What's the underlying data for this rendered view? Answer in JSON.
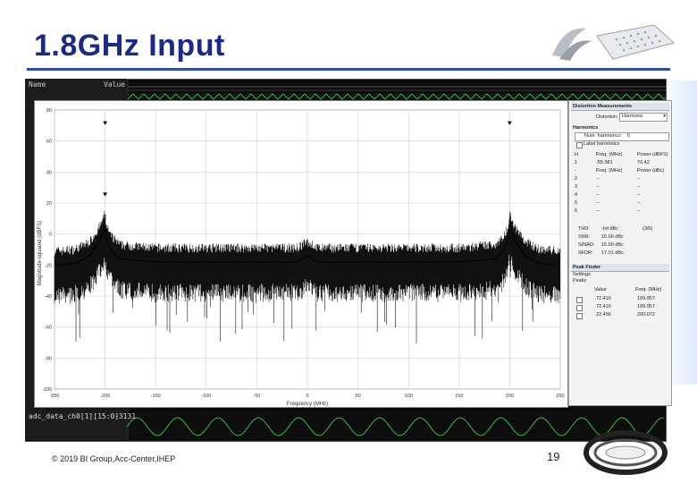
{
  "slide": {
    "title": "1.8GHz Input",
    "footer": "© 2019 BI Group,Acc-Center,IHEP",
    "page_number": "19"
  },
  "scope": {
    "col_name": "Name",
    "col_value": "Value",
    "footer_label": "adc_data_ch0[1][15:0]",
    "footer_value": "-3131"
  },
  "chart_data": {
    "type": "line",
    "xlabel": "Frequency (MHz)",
    "ylabel": "Magnitude-squared (dBFS)",
    "xlim": [
      -250,
      250
    ],
    "ylim": [
      -100,
      80
    ],
    "xticks": [
      -250,
      -200,
      -150,
      -100,
      -50,
      0,
      50,
      100,
      150,
      200,
      250
    ],
    "yticks": [
      80,
      60,
      40,
      20,
      0,
      -20,
      -40,
      -60,
      -80,
      -100
    ],
    "grid": true,
    "series": [
      {
        "x": [
          -250,
          -230,
          -215,
          -205,
          -201,
          -200,
          -199,
          -195,
          -185,
          -150,
          -100,
          -50,
          -10,
          0,
          10,
          50,
          100,
          150,
          185,
          195,
          199,
          200,
          201,
          205,
          215,
          230,
          250
        ],
        "y": [
          -20,
          -19,
          -14,
          -4,
          2,
          5,
          -2,
          -10,
          -16,
          -18,
          -18,
          -18,
          -18,
          -14,
          -18,
          -18,
          -18,
          -18,
          -16,
          -10,
          -2,
          5,
          2,
          -4,
          -14,
          -19,
          -20
        ]
      }
    ],
    "markers": [
      {
        "x": -200,
        "y": 71
      },
      {
        "x": -200,
        "y": 25
      },
      {
        "x": 200,
        "y": 71
      }
    ]
  },
  "panel": {
    "dist_header": "Distortion Measurements",
    "dist_label": "Distortion:",
    "dist_value": "Harmonic",
    "harm_header": "Harmonics",
    "num_harm_label": "Num. harmonics:",
    "num_harm_value": "6",
    "label_harm": "Label harmonics",
    "table_cols": [
      "H",
      "Freq. (MHz)",
      "Power (dBFS)"
    ],
    "rows": [
      [
        "1",
        "-55.981",
        "73.42"
      ],
      [
        "-",
        "Freq. (MHz)",
        "Power (dBc)"
      ],
      [
        "2",
        "--",
        "--"
      ],
      [
        "3",
        "--",
        "--"
      ],
      [
        "4",
        "--",
        "--"
      ],
      [
        "5",
        "--",
        "--"
      ],
      [
        "6",
        "--",
        "--"
      ]
    ],
    "metrics": [
      [
        "THD:",
        "-Inf dBc",
        "(3/6)"
      ],
      [
        "SNR:",
        "15.00 dBc",
        ""
      ],
      [
        "SINAD:",
        "15.00 dBc",
        ""
      ],
      [
        "SFDR:",
        "17.01 dBc",
        ""
      ]
    ],
    "peak_header": "Peak Finder",
    "settings_label": "Settings",
    "peaks_label": "Peaks",
    "peak_cols": [
      "Value",
      "Freq. (MHz)"
    ],
    "peaks": [
      [
        "72.416",
        "199.957"
      ],
      [
        "72.416",
        "199.957"
      ],
      [
        "22.456",
        "200.072"
      ]
    ]
  }
}
